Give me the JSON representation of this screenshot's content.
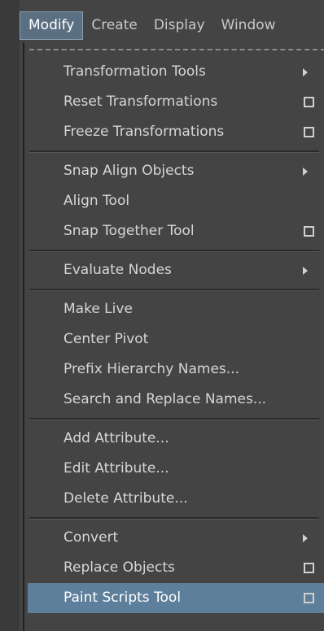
{
  "menubar": {
    "items": [
      "Modify",
      "Create",
      "Display",
      "Window"
    ]
  },
  "menu": {
    "groups": [
      [
        {
          "label": "Transformation Tools",
          "icon": "submenu-arrow-icon"
        },
        {
          "label": "Reset Transformations",
          "icon": "option-box-icon"
        },
        {
          "label": "Freeze Transformations",
          "icon": "option-box-icon"
        }
      ],
      [
        {
          "label": "Snap Align Objects",
          "icon": "submenu-arrow-icon"
        },
        {
          "label": "Align Tool",
          "icon": null
        },
        {
          "label": "Snap Together Tool",
          "icon": "option-box-icon"
        }
      ],
      [
        {
          "label": "Evaluate Nodes",
          "icon": "submenu-arrow-icon"
        }
      ],
      [
        {
          "label": "Make Live",
          "icon": null
        },
        {
          "label": "Center Pivot",
          "icon": null
        },
        {
          "label": "Prefix Hierarchy Names...",
          "icon": null
        },
        {
          "label": "Search and Replace Names...",
          "icon": null
        }
      ],
      [
        {
          "label": "Add Attribute...",
          "icon": null
        },
        {
          "label": "Edit Attribute...",
          "icon": null
        },
        {
          "label": "Delete Attribute...",
          "icon": null
        }
      ],
      [
        {
          "label": "Convert",
          "icon": "submenu-arrow-icon"
        },
        {
          "label": "Replace Objects",
          "icon": "option-box-icon"
        },
        {
          "label": "Paint Scripts Tool",
          "icon": "option-box-icon",
          "highlighted": true
        }
      ]
    ]
  },
  "colors": {
    "menu_bg": "#444444",
    "highlight": "#5e7f9b",
    "active_menubar": "#5b6f82"
  }
}
